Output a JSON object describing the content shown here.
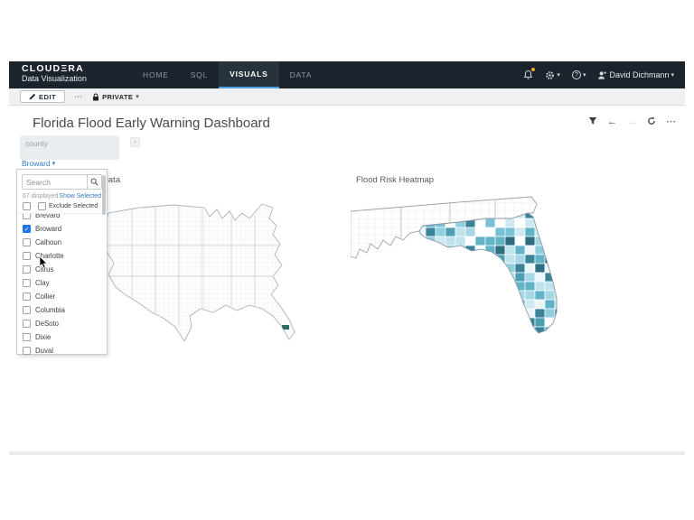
{
  "brand": {
    "name": "CLOUDΞRA",
    "product": "Data Visualization"
  },
  "nav": {
    "items": [
      {
        "label": "HOME",
        "active": false
      },
      {
        "label": "SQL",
        "active": false
      },
      {
        "label": "VISUALS",
        "active": true
      },
      {
        "label": "DATA",
        "active": false
      }
    ]
  },
  "header": {
    "user_name": "David Dichmann"
  },
  "toolbar": {
    "edit_label": "EDIT",
    "more_label": "⋯",
    "privacy_label": "PRIVATE"
  },
  "dashboard": {
    "title": "Florida Flood Early Warning Dashboard"
  },
  "icons": {
    "caret": "▾",
    "back": "←",
    "forward": "→",
    "ellipsis": "⋯",
    "check": "✓",
    "help": "?"
  },
  "filter": {
    "field_placeholder": "county",
    "selected_value": "Broward",
    "search_placeholder": "Search",
    "displayed_count": "67 displayed",
    "show_selected_label": "Show Selected",
    "exclude_selected_label": "Exclude Selected",
    "items": [
      {
        "label": "Brevard",
        "checked": false
      },
      {
        "label": "Broward",
        "checked": true
      },
      {
        "label": "Calhoun",
        "checked": false
      },
      {
        "label": "Charlotte",
        "checked": false
      },
      {
        "label": "Citrus",
        "checked": false
      },
      {
        "label": "Clay",
        "checked": false
      },
      {
        "label": "Collier",
        "checked": false
      },
      {
        "label": "Columbia",
        "checked": false
      },
      {
        "label": "DeSoto",
        "checked": false
      },
      {
        "label": "Dixie",
        "checked": false
      },
      {
        "label": "Duval",
        "checked": false
      }
    ]
  },
  "visuals": {
    "left_title": "Precipitation Data",
    "right_title": "Flood Risk Heatmap"
  },
  "colors": {
    "nav_bg": "#1b242c",
    "active_tab_underline": "#4a9fe3",
    "accent_blue": "#2e7bc0",
    "bell_badge": "#f5a623",
    "checkbox_checked": "#1a73e8",
    "selected_county_highlight": "#2e6e62",
    "heatmap_palette": [
      "#ffffff",
      "#eaf6f9",
      "#cfe9f0",
      "#bfe3ec",
      "#a5d8e4",
      "#8fcede",
      "#79c2d4",
      "#62b3c8",
      "#4d9fb4",
      "#3a8399",
      "#2f6e81"
    ]
  }
}
